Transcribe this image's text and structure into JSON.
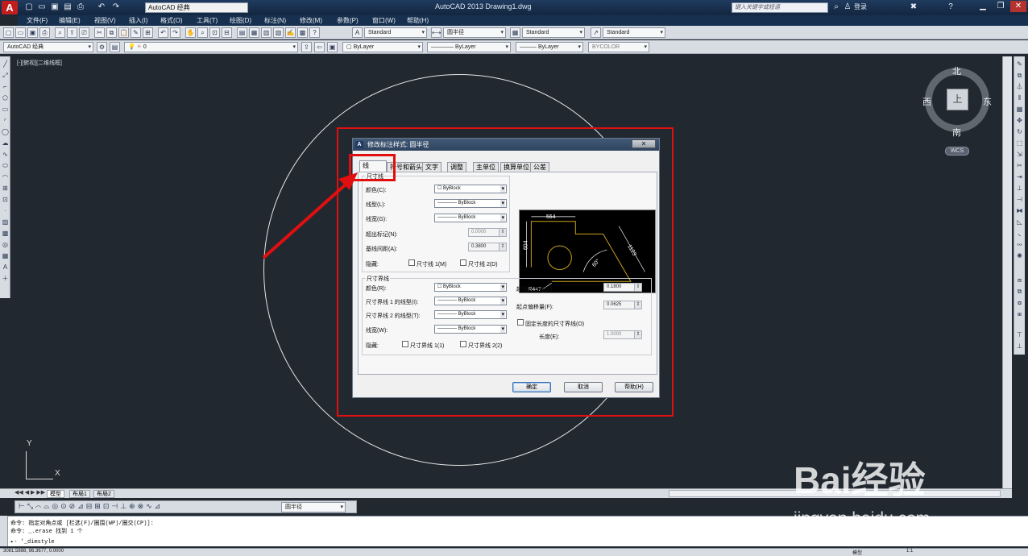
{
  "titlebar": {
    "app_title": "AutoCAD 2013    Drawing1.dwg",
    "workspace": "AutoCAD 经典",
    "search_placeholder": "键入关键字或短语",
    "login_label": "登录"
  },
  "menu": [
    "文件(F)",
    "编辑(E)",
    "视图(V)",
    "插入(I)",
    "格式(O)",
    "工具(T)",
    "绘图(D)",
    "标注(N)",
    "修改(M)",
    "参数(P)",
    "窗口(W)",
    "帮助(H)"
  ],
  "toolbar2": {
    "text_style": "Standard",
    "dim_style": "圆半径",
    "table_style": "Standard",
    "mleader_style": "Standard"
  },
  "toolbar3": {
    "workspace": "AutoCAD 经典",
    "layer": "0",
    "color": "ByLayer",
    "linetype": "ByLayer",
    "lineweight": "ByLayer",
    "plotstyle": "BYCOLOR"
  },
  "viewport": {
    "label": "[-][俯视][二维线框]",
    "viewcube": {
      "north": "北",
      "south": "南",
      "west": "西",
      "east": "东",
      "top": "上",
      "wcs": "WCS"
    },
    "ucs": {
      "x": "X",
      "y": "Y"
    }
  },
  "dialog": {
    "title": "修改标注样式: 圆半径",
    "close": "✕",
    "tabs": [
      "线",
      "符号和箭头",
      "文字",
      "调整",
      "主单位",
      "换算单位",
      "公差"
    ],
    "active_tab": "线",
    "dimlines": {
      "group": "尺寸线",
      "color_label": "颜色(C):",
      "color_value": "ByBlock",
      "linetype_label": "线型(L):",
      "linetype_value": "ByBlock",
      "lineweight_label": "线宽(G):",
      "lineweight_value": "ByBlock",
      "extend_label": "超出标记(N):",
      "extend_value": "0.0000",
      "baseline_label": "基线间距(A):",
      "baseline_value": "0.3800",
      "suppress_label": "隐藏:",
      "suppress1": "尺寸线 1(M)",
      "suppress2": "尺寸线 2(D)"
    },
    "extlines": {
      "group": "尺寸界线",
      "color_label": "颜色(R):",
      "color_value": "ByBlock",
      "lt1_label": "尺寸界线 1 的线型(I):",
      "lt1_value": "ByBlock",
      "lt2_label": "尺寸界线 2 的线型(T):",
      "lt2_value": "ByBlock",
      "lw_label": "线宽(W):",
      "lw_value": "ByBlock",
      "suppress_label": "隐藏:",
      "suppress1": "尺寸界线 1(1)",
      "suppress2": "尺寸界线 2(2)",
      "beyond_label": "超出尺寸线(X):",
      "beyond_value": "0.1800",
      "offset_label": "起点偏移量(F):",
      "offset_value": "0.0625",
      "fixed_label": "固定长度的尺寸界线(O)",
      "length_label": "长度(E):",
      "length_value": "1.0000"
    },
    "preview": {
      "d1": "564",
      "d2": "604",
      "d3": "1123",
      "angle": "60°",
      "radius": "R447"
    },
    "buttons": {
      "ok": "确定",
      "cancel": "取消",
      "help": "帮助(H)"
    }
  },
  "layout_tabs": [
    "模型",
    "布局1",
    "布局2"
  ],
  "bottom_toolbar": {
    "dimstyle": "圆半径"
  },
  "command": {
    "line1": "命令: 指定对角点或 [栏选(F)/圈围(WP)/圈交(CP)]:",
    "line2": "命令: _.erase 找到 1 个",
    "prompt": "▸- '_dimstyle"
  },
  "statusbar": {
    "coords": "3081.5888, 86.3677, 0.0000",
    "model": "模型",
    "scale": "1:1"
  },
  "watermark": {
    "brand": "Bai经验",
    "url": "jingyan.baidu.com"
  }
}
